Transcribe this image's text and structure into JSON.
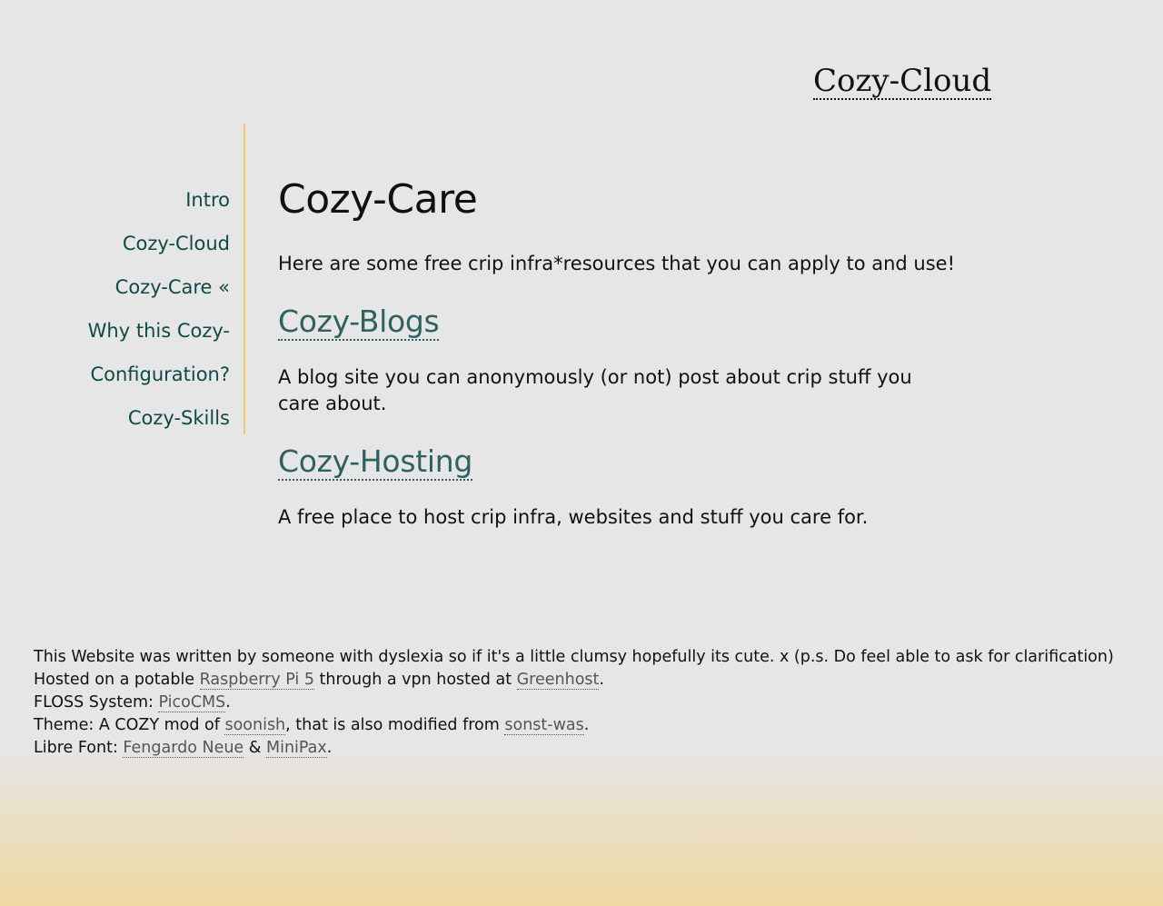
{
  "header": {
    "site_title": "Cozy-Cloud"
  },
  "sidebar": {
    "items": [
      {
        "label": "Intro"
      },
      {
        "label": "Cozy-Cloud"
      },
      {
        "label": "Cozy-Care «"
      },
      {
        "label": "Why this Cozy-"
      },
      {
        "label": "Configuration?"
      },
      {
        "label": "Cozy-Skills"
      }
    ]
  },
  "main": {
    "title": "Cozy-Care",
    "intro": "Here are some free crip infra*resources that you can apply to and use!",
    "sections": [
      {
        "heading": "Cozy-Blogs",
        "text": "A blog site you can anonymously (or not) post about crip stuff you care about."
      },
      {
        "heading": "Cozy-Hosting",
        "text": "A free place to host crip infra, websites and stuff you care for."
      }
    ]
  },
  "footer": {
    "line1": "This Website was written by someone with dyslexia so if it's a little clumsy hopefully its cute. x (p.s. Do feel able to ask for clarification)",
    "line2": {
      "prefix": "Hosted on a potable ",
      "link1": "Raspberry Pi 5",
      "middle": " through a vpn hosted at ",
      "link2": "Greenhost",
      "suffix": "."
    },
    "line3": {
      "prefix": "FLOSS System: ",
      "link1": "PicoCMS",
      "suffix": "."
    },
    "line4": {
      "prefix": "Theme: A COZY mod of ",
      "link1": "soonish",
      "middle": ", that is also modified from ",
      "link2": "sonst-was",
      "suffix": "."
    },
    "line5": {
      "prefix": "Libre Font: ",
      "link1": "Fengardo Neue",
      "middle": " & ",
      "link2": "MiniPax",
      "suffix": "."
    }
  }
}
